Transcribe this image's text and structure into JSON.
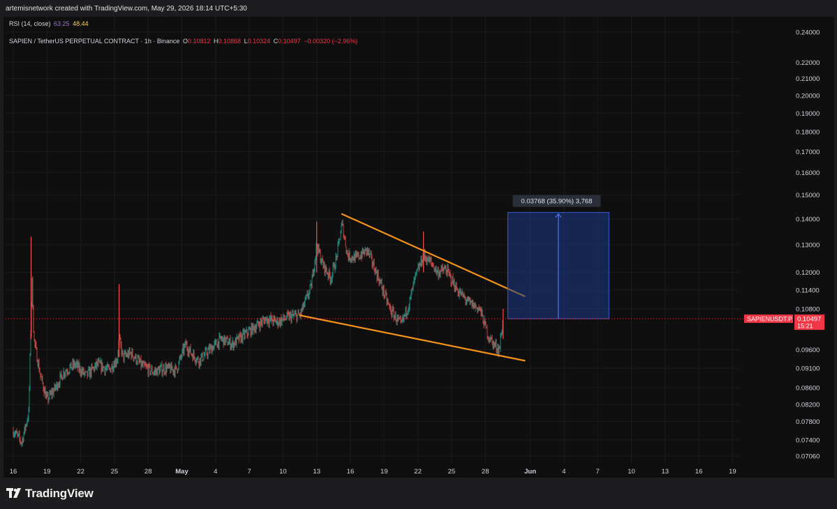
{
  "header": {
    "creator_text": "artemisnetwork created with TradingView.com, May 29, 2026 18:14 UTC+5:30"
  },
  "rsi_legend": {
    "label": "RSI (14, close)",
    "value1": "63.25",
    "value2": "48.44",
    "value1_color": "#9575cd",
    "value2_color": "#ffd54f"
  },
  "symbol_legend": {
    "name": "SAPIEN / TetherUS PERPETUAL CONTRACT · 1h · Binance",
    "o_label": "O",
    "o_value": "0.10812",
    "h_label": "H",
    "h_value": "0.10868",
    "l_label": "L",
    "l_value": "0.10324",
    "c_label": "C",
    "c_value": "0.10497",
    "change": "−0.00320 (−2.96%)",
    "change_color": "#f23645"
  },
  "measure_label": "0.03768 (35.90%) 3,768",
  "price_tag": {
    "symbol": "SAPIENUSDT.P",
    "price": "0.10497",
    "countdown": "15:21"
  },
  "footer": {
    "brand": "TradingView"
  },
  "colors": {
    "up": "#26a69a",
    "down": "#ef5350",
    "trendline": "#f7931a",
    "measure_fill": "#1e3a8a",
    "measure_line": "#3b5bdb",
    "price_line": "#f23645"
  },
  "chart_data": {
    "type": "candlestick",
    "title": "SAPIEN / TetherUS PERPETUAL CONTRACT · 1h · Binance",
    "y_scale": "log",
    "ylim": [
      0.0695,
      0.243
    ],
    "y_ticks": [
      "0.24000",
      "0.22000",
      "0.21000",
      "0.20000",
      "0.19000",
      "0.18000",
      "0.17000",
      "0.16000",
      "0.15000",
      "0.14000",
      "0.13000",
      "0.12000",
      "0.11400",
      "0.10800",
      "0.09600",
      "0.09100",
      "0.08600",
      "0.08200",
      "0.07800",
      "0.07400",
      "0.07060"
    ],
    "x_ticks": [
      "16",
      "19",
      "22",
      "25",
      "28",
      "May",
      "4",
      "7",
      "10",
      "13",
      "16",
      "19",
      "22",
      "25",
      "28",
      "Jun",
      "4",
      "7",
      "10",
      "13",
      "16",
      "19"
    ],
    "x_tick_dates": [
      "2026-04-16",
      "2026-04-19",
      "2026-04-22",
      "2026-04-25",
      "2026-04-28",
      "2026-05-01",
      "2026-05-04",
      "2026-05-07",
      "2026-05-10",
      "2026-05-13",
      "2026-05-16",
      "2026-05-19",
      "2026-05-22",
      "2026-05-25",
      "2026-05-28",
      "2026-06-01",
      "2026-06-04",
      "2026-06-07",
      "2026-06-10",
      "2026-06-13",
      "2026-06-16",
      "2026-06-19"
    ],
    "price_path": [
      [
        "2026-04-16T00:00",
        0.076
      ],
      [
        "2026-04-16T18:00",
        0.0735
      ],
      [
        "2026-04-17T09:00",
        0.08
      ],
      [
        "2026-04-17T13:00",
        0.1
      ],
      [
        "2026-04-17T16:00",
        0.118
      ],
      [
        "2026-04-17T20:00",
        0.099
      ],
      [
        "2026-04-18T10:00",
        0.089
      ],
      [
        "2026-04-19T00:00",
        0.083
      ],
      [
        "2026-04-19T18:00",
        0.086
      ],
      [
        "2026-04-20T12:00",
        0.09
      ],
      [
        "2026-04-21T12:00",
        0.092
      ],
      [
        "2026-04-22T12:00",
        0.089
      ],
      [
        "2026-04-23T12:00",
        0.092
      ],
      [
        "2026-04-24T12:00",
        0.0905
      ],
      [
        "2026-04-25T06:00",
        0.0935
      ],
      [
        "2026-04-25T10:00",
        0.099
      ],
      [
        "2026-04-25T18:00",
        0.094
      ],
      [
        "2026-04-26T12:00",
        0.095
      ],
      [
        "2026-04-27T12:00",
        0.0915
      ],
      [
        "2026-04-28T12:00",
        0.09
      ],
      [
        "2026-04-29T12:00",
        0.091
      ],
      [
        "2026-04-30T12:00",
        0.0905
      ],
      [
        "2026-05-01T08:00",
        0.0975
      ],
      [
        "2026-05-01T20:00",
        0.095
      ],
      [
        "2026-05-02T12:00",
        0.093
      ],
      [
        "2026-05-03T12:00",
        0.096
      ],
      [
        "2026-05-04T12:00",
        0.099
      ],
      [
        "2026-05-05T12:00",
        0.0975
      ],
      [
        "2026-05-06T12:00",
        0.1
      ],
      [
        "2026-05-07T12:00",
        0.1025
      ],
      [
        "2026-05-08T12:00",
        0.105
      ],
      [
        "2026-05-09T12:00",
        0.104
      ],
      [
        "2026-05-10T12:00",
        0.1055
      ],
      [
        "2026-05-11T12:00",
        0.106
      ],
      [
        "2026-05-12T12:00",
        0.115
      ],
      [
        "2026-05-13T00:00",
        0.13
      ],
      [
        "2026-05-13T12:00",
        0.123
      ],
      [
        "2026-05-14T06:00",
        0.118
      ],
      [
        "2026-05-14T18:00",
        0.125
      ],
      [
        "2026-05-15T06:00",
        0.138
      ],
      [
        "2026-05-15T18:00",
        0.126
      ],
      [
        "2026-05-16T12:00",
        0.125
      ],
      [
        "2026-05-17T12:00",
        0.128
      ],
      [
        "2026-05-18T12:00",
        0.118
      ],
      [
        "2026-05-19T12:00",
        0.108
      ],
      [
        "2026-05-20T12:00",
        0.103
      ],
      [
        "2026-05-21T06:00",
        0.11
      ],
      [
        "2026-05-21T18:00",
        0.118
      ],
      [
        "2026-05-22T12:00",
        0.126
      ],
      [
        "2026-05-23T06:00",
        0.123
      ],
      [
        "2026-05-23T18:00",
        0.12
      ],
      [
        "2026-05-24T12:00",
        0.121
      ],
      [
        "2026-05-25T12:00",
        0.114
      ],
      [
        "2026-05-26T12:00",
        0.11
      ],
      [
        "2026-05-27T12:00",
        0.108
      ],
      [
        "2026-05-28T06:00",
        0.1
      ],
      [
        "2026-05-28T18:00",
        0.0975
      ],
      [
        "2026-05-29T06:00",
        0.096
      ],
      [
        "2026-05-29T14:00",
        0.105
      ]
    ],
    "spikes": [
      {
        "time": "2026-04-17T14:00",
        "high": 0.133,
        "low": 0.099
      },
      {
        "time": "2026-04-25T10:00",
        "high": 0.116,
        "low": 0.094
      },
      {
        "time": "2026-05-13T00:00",
        "high": 0.139,
        "low": 0.12
      },
      {
        "time": "2026-05-22T12:00",
        "high": 0.135,
        "low": 0.12
      },
      {
        "time": "2026-05-29T14:00",
        "high": 0.108,
        "low": 0.099
      }
    ],
    "trendlines": [
      {
        "name": "upper",
        "from": [
          "2026-05-15T06:00",
          0.142
        ],
        "to": [
          "2026-05-31T12:00",
          0.112
        ]
      },
      {
        "name": "lower",
        "from": [
          "2026-05-11T12:00",
          0.106
        ],
        "to": [
          "2026-05-31T12:00",
          0.093
        ]
      }
    ],
    "measure": {
      "from": [
        "2026-05-30T00:00",
        0.10497
      ],
      "to": [
        "2026-06-08T00:00",
        0.14265
      ],
      "label": "0.03768 (35.90%) 3,768"
    },
    "last_price": 0.10497
  }
}
